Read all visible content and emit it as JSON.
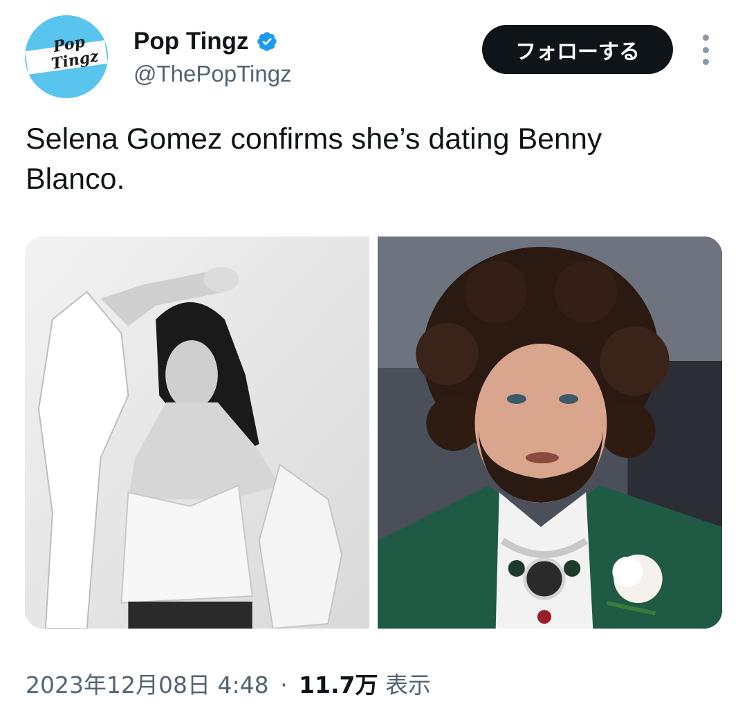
{
  "account": {
    "display_name": "Pop Tingz",
    "handle": "@ThePopTingz",
    "verified": true,
    "avatar_colors": {
      "background": "#59c4ee",
      "strip": "#ffffff"
    },
    "avatar_logo_text": "Pop Tingz"
  },
  "actions": {
    "follow_label": "フォローする",
    "more_icon": "vertical-ellipsis-icon"
  },
  "tweet": {
    "text": "Selena Gomez confirms she’s dating Benny Blanco."
  },
  "media": [
    {
      "name": "photo-selena-gomez",
      "style": "black-and-white portrait"
    },
    {
      "name": "photo-benny-blanco",
      "style": "color portrait, green suit"
    }
  ],
  "meta": {
    "timestamp": "2023年12月08日 4:48",
    "separator": "·",
    "views_count": "11.7万",
    "views_label": "表示"
  },
  "colors": {
    "text_primary": "#0f1419",
    "text_secondary": "#536471",
    "verified_blue": "#1d9bf0",
    "button_bg": "#0f1419"
  }
}
